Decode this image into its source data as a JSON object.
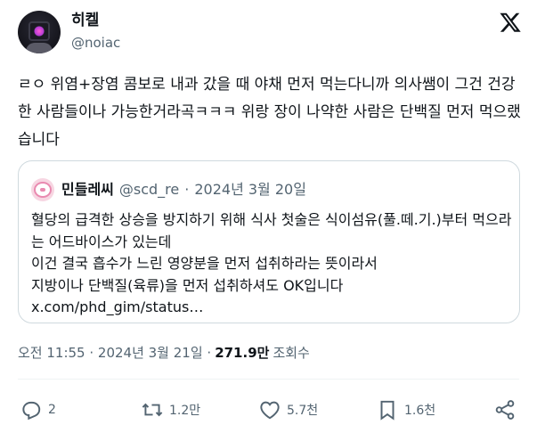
{
  "author": {
    "display_name": "히켈",
    "handle": "@noiac"
  },
  "body_text": "ㄹㅇ 위염+장염 콤보로 내과 갔을 때 야채 먼저 먹는다니까 의사쌤이 그건 건강한 사람들이나 가능한거라곡ㅋㅋㅋ 위랑 장이 나약한 사람은 단백질 먼저 먹으랬습니다",
  "quote": {
    "display_name": "민들레씨",
    "handle": "@scd_re",
    "separator": "·",
    "date": "2024년 3월 20일",
    "text": "혈당의 급격한 상승을 방지하기 위해 식사 첫술은 식이섬유(풀.떼.기.)부터 먹으라는 어드바이스가 있는데\n이건 결국 흡수가 느린 영양분을 먼저 섭취하라는 뜻이라서\n지방이나 단백질(육류)을 먼저 섭취하셔도 OK입니다 x.com/phd_gim/status…"
  },
  "timestamp": {
    "time_date": "오전 11:55 · 2024년 3월 21일 ·",
    "views_count": "271.9만",
    "views_label": "조회수"
  },
  "actions": {
    "reply_count": "2",
    "retweet_count": "1.2만",
    "like_count": "5.7천",
    "bookmark_count": "1.6천"
  },
  "icons": {
    "logo": "x-logo-icon",
    "reply": "reply-icon",
    "retweet": "retweet-icon",
    "like": "heart-icon",
    "bookmark": "bookmark-icon",
    "share": "share-icon"
  },
  "colors": {
    "text_primary": "#0f1419",
    "text_secondary": "#536471",
    "border": "#cfd9de"
  }
}
